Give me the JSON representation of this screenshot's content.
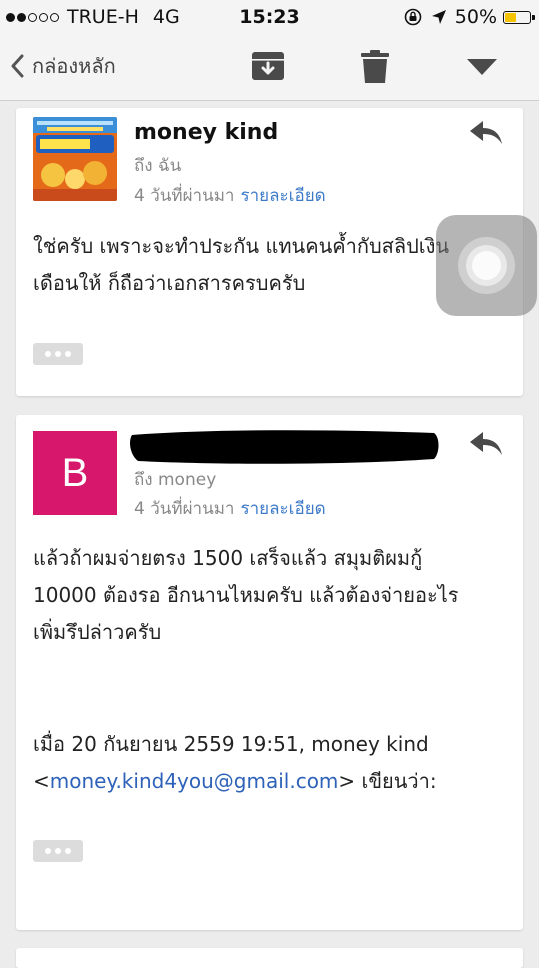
{
  "status": {
    "carrier": "TRUE-H",
    "network": "4G",
    "time": "15:23",
    "battery": "50%",
    "battery_level": 0.5,
    "signal_bars_filled": 2,
    "signal_bars_total": 5
  },
  "nav": {
    "back_label": "กล่องหลัก",
    "icons": [
      "archive-icon",
      "trash-icon",
      "chevron-down-icon"
    ]
  },
  "messages": [
    {
      "sender": "money kind",
      "to": "ถึง ฉัน",
      "time": "4 วันที่ผ่านมา",
      "details_link": "รายละเอียด",
      "body": [
        "ใช่ครับ เพราะจะทำประกัน แทนคนค้ำกับสลิปเงิน",
        "เดือนให้ ก็ถือว่าเอกสารครบครับ"
      ]
    },
    {
      "avatar_letter": "B",
      "avatar_color": "#d6176b",
      "to": "ถึง money",
      "time": "4 วันที่ผ่านมา",
      "details_link": "รายละเอียด",
      "body": [
        "แล้วถ้าผมจ่ายตรง 1500 เสร็จแล้ว สมุมติผมกู้",
        "10000 ต้องรอ อีกนานไหมครับ แล้วต้องจ่ายอะไร",
        "เพิ่มรึปล่าวครับ"
      ],
      "quote_header": "เมื่อ 20 กันยายน 2559 19:51, money kind",
      "quote_open": "<",
      "quote_email": "money.kind4you@gmail.com",
      "quote_suffix": "> เขียนว่า:"
    }
  ],
  "colors": {
    "link": "#3d7bc9",
    "background": "#ececec",
    "battery": "#f5c400"
  }
}
